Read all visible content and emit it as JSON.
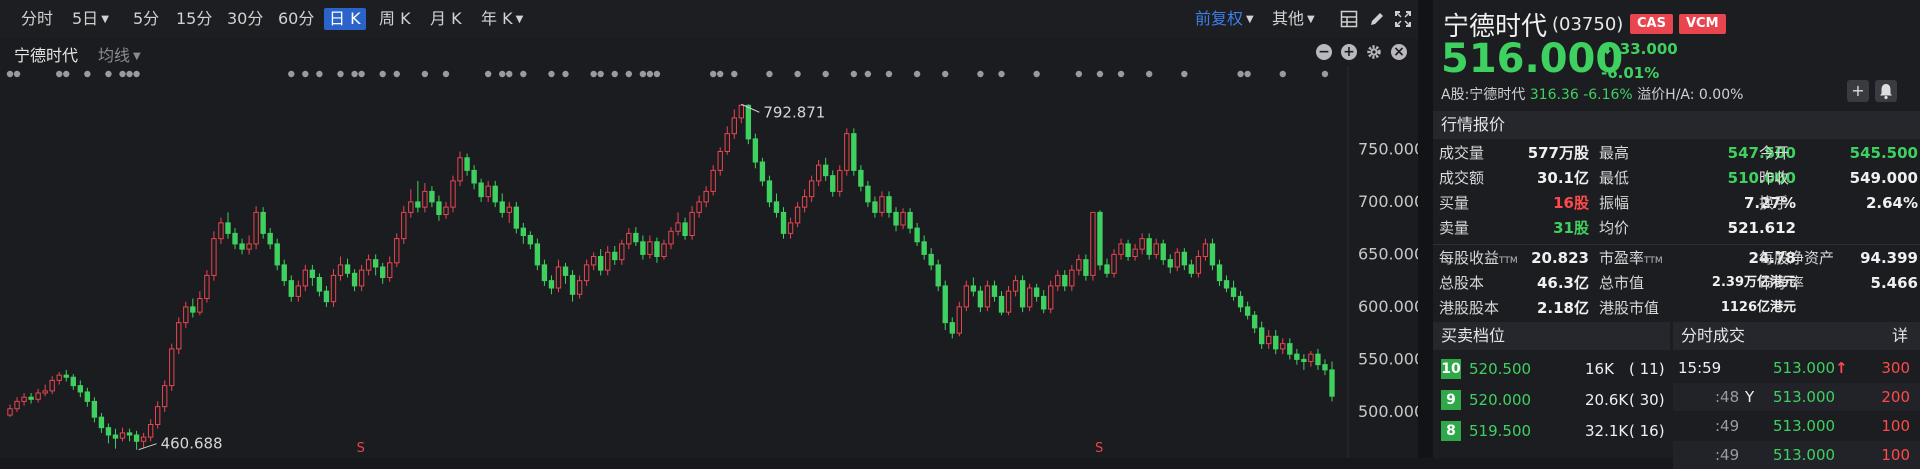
{
  "toolbar": {
    "periods": [
      "分时",
      "5日",
      "5分",
      "15分",
      "30分",
      "60分",
      "日 K",
      "周 K",
      "月 K",
      "年 K"
    ],
    "active": "日 K",
    "adjust": "前复权",
    "other": "其他"
  },
  "subbar": {
    "stock": "宁德时代",
    "ma": "均线"
  },
  "chart_data": {
    "type": "candlestick",
    "y_ticks": [
      "750.000",
      "700.000",
      "650.000",
      "600.000",
      "550.000",
      "500.000"
    ],
    "ylim": [
      458,
      818
    ],
    "high_label": "792.871",
    "low_label": "460.688",
    "marker": "S",
    "up_color": "#e8454f",
    "down_color": "#3fd160",
    "candles": [
      [
        497,
        503,
        495,
        507
      ],
      [
        503,
        510,
        500,
        514
      ],
      [
        510,
        514,
        506,
        518
      ],
      [
        514,
        512,
        508,
        518
      ],
      [
        512,
        518,
        509,
        522
      ],
      [
        518,
        520,
        515,
        526
      ],
      [
        520,
        530,
        517,
        534
      ],
      [
        530,
        535,
        526,
        538
      ],
      [
        535,
        533,
        529,
        540
      ],
      [
        533,
        525,
        521,
        536
      ],
      [
        525,
        519,
        514,
        530
      ],
      [
        519,
        510,
        505,
        523
      ],
      [
        510,
        495,
        490,
        514
      ],
      [
        495,
        485,
        480,
        499
      ],
      [
        485,
        478,
        470,
        489
      ],
      [
        478,
        475,
        465,
        484
      ],
      [
        475,
        480,
        472,
        485
      ],
      [
        480,
        478,
        472,
        484
      ],
      [
        478,
        472,
        464,
        482
      ],
      [
        472,
        476,
        466,
        480
      ],
      [
        476,
        488,
        472,
        493
      ],
      [
        488,
        505,
        484,
        510
      ],
      [
        505,
        525,
        500,
        530
      ],
      [
        525,
        560,
        520,
        565
      ],
      [
        560,
        585,
        555,
        590
      ],
      [
        585,
        600,
        580,
        605
      ],
      [
        600,
        595,
        590,
        608
      ],
      [
        595,
        608,
        592,
        615
      ],
      [
        608,
        630,
        604,
        635
      ],
      [
        630,
        665,
        625,
        672
      ],
      [
        665,
        680,
        660,
        685
      ],
      [
        680,
        670,
        665,
        690
      ],
      [
        670,
        660,
        655,
        675
      ],
      [
        660,
        655,
        650,
        665
      ],
      [
        655,
        660,
        650,
        668
      ],
      [
        660,
        690,
        655,
        696
      ],
      [
        690,
        670,
        665,
        695
      ],
      [
        670,
        660,
        655,
        675
      ],
      [
        660,
        640,
        635,
        665
      ],
      [
        640,
        625,
        620,
        645
      ],
      [
        625,
        610,
        605,
        630
      ],
      [
        610,
        620,
        605,
        625
      ],
      [
        620,
        635,
        615,
        640
      ],
      [
        635,
        628,
        620,
        640
      ],
      [
        628,
        615,
        610,
        632
      ],
      [
        615,
        605,
        600,
        620
      ],
      [
        605,
        630,
        600,
        636
      ],
      [
        630,
        640,
        625,
        648
      ],
      [
        640,
        632,
        628,
        646
      ],
      [
        632,
        620,
        615,
        636
      ],
      [
        620,
        635,
        615,
        640
      ],
      [
        635,
        645,
        630,
        650
      ],
      [
        645,
        638,
        630,
        650
      ],
      [
        638,
        628,
        622,
        642
      ],
      [
        628,
        642,
        624,
        648
      ],
      [
        642,
        665,
        638,
        670
      ],
      [
        665,
        690,
        660,
        696
      ],
      [
        690,
        700,
        685,
        712
      ],
      [
        700,
        695,
        690,
        720
      ],
      [
        695,
        710,
        690,
        718
      ],
      [
        710,
        700,
        695,
        715
      ],
      [
        700,
        688,
        682,
        706
      ],
      [
        688,
        695,
        684,
        700
      ],
      [
        695,
        720,
        690,
        725
      ],
      [
        720,
        742,
        715,
        748
      ],
      [
        742,
        730,
        725,
        746
      ],
      [
        730,
        718,
        712,
        735
      ],
      [
        718,
        705,
        700,
        722
      ],
      [
        705,
        715,
        700,
        720
      ],
      [
        715,
        700,
        695,
        720
      ],
      [
        700,
        690,
        685,
        708
      ],
      [
        690,
        695,
        680,
        700
      ],
      [
        695,
        675,
        670,
        700
      ],
      [
        675,
        668,
        660,
        680
      ],
      [
        668,
        660,
        655,
        672
      ],
      [
        660,
        640,
        635,
        665
      ],
      [
        640,
        625,
        620,
        645
      ],
      [
        625,
        618,
        612,
        630
      ],
      [
        618,
        638,
        614,
        645
      ],
      [
        638,
        630,
        622,
        642
      ],
      [
        630,
        612,
        605,
        635
      ],
      [
        612,
        625,
        608,
        630
      ],
      [
        625,
        640,
        620,
        645
      ],
      [
        640,
        648,
        635,
        652
      ],
      [
        648,
        635,
        630,
        655
      ],
      [
        635,
        652,
        630,
        658
      ],
      [
        652,
        645,
        640,
        658
      ],
      [
        645,
        660,
        640,
        664
      ],
      [
        660,
        670,
        655,
        675
      ],
      [
        670,
        662,
        658,
        676
      ],
      [
        662,
        650,
        645,
        668
      ],
      [
        650,
        662,
        646,
        668
      ],
      [
        662,
        648,
        642,
        666
      ],
      [
        648,
        660,
        645,
        664
      ],
      [
        660,
        672,
        655,
        676
      ],
      [
        672,
        680,
        668,
        690
      ],
      [
        680,
        668,
        664,
        685
      ],
      [
        668,
        690,
        664,
        696
      ],
      [
        690,
        700,
        685,
        706
      ],
      [
        700,
        710,
        695,
        715
      ],
      [
        710,
        730,
        706,
        735
      ],
      [
        730,
        748,
        725,
        752
      ],
      [
        748,
        765,
        745,
        772
      ],
      [
        765,
        780,
        760,
        788
      ],
      [
        780,
        792,
        775,
        793
      ],
      [
        792,
        760,
        755,
        793
      ],
      [
        760,
        738,
        732,
        765
      ],
      [
        738,
        720,
        715,
        742
      ],
      [
        720,
        700,
        695,
        725
      ],
      [
        700,
        690,
        685,
        708
      ],
      [
        690,
        670,
        665,
        695
      ],
      [
        670,
        680,
        665,
        685
      ],
      [
        680,
        695,
        676,
        700
      ],
      [
        695,
        705,
        690,
        712
      ],
      [
        705,
        720,
        700,
        725
      ],
      [
        720,
        735,
        715,
        740
      ],
      [
        735,
        725,
        720,
        742
      ],
      [
        725,
        710,
        705,
        730
      ],
      [
        710,
        730,
        705,
        735
      ],
      [
        730,
        765,
        725,
        770
      ],
      [
        765,
        730,
        725,
        770
      ],
      [
        730,
        715,
        710,
        735
      ],
      [
        715,
        700,
        695,
        720
      ],
      [
        700,
        690,
        685,
        705
      ],
      [
        690,
        705,
        686,
        710
      ],
      [
        705,
        690,
        685,
        710
      ],
      [
        690,
        678,
        672,
        695
      ],
      [
        678,
        690,
        674,
        694
      ],
      [
        690,
        675,
        670,
        694
      ],
      [
        675,
        662,
        658,
        680
      ],
      [
        662,
        650,
        645,
        668
      ],
      [
        650,
        640,
        635,
        656
      ],
      [
        640,
        620,
        615,
        645
      ],
      [
        620,
        585,
        578,
        625
      ],
      [
        585,
        575,
        570,
        590
      ],
      [
        575,
        600,
        572,
        605
      ],
      [
        600,
        620,
        596,
        625
      ],
      [
        620,
        615,
        610,
        628
      ],
      [
        615,
        600,
        595,
        620
      ],
      [
        600,
        620,
        596,
        625
      ],
      [
        620,
        610,
        605,
        625
      ],
      [
        610,
        595,
        592,
        615
      ],
      [
        595,
        615,
        592,
        620
      ],
      [
        615,
        625,
        610,
        630
      ],
      [
        625,
        600,
        595,
        630
      ],
      [
        600,
        618,
        596,
        622
      ],
      [
        618,
        610,
        605,
        622
      ],
      [
        610,
        598,
        594,
        616
      ],
      [
        598,
        620,
        594,
        625
      ],
      [
        620,
        630,
        615,
        635
      ],
      [
        630,
        620,
        615,
        635
      ],
      [
        620,
        635,
        615,
        640
      ],
      [
        635,
        645,
        630,
        650
      ],
      [
        645,
        630,
        625,
        650
      ],
      [
        630,
        690,
        625,
        690
      ],
      [
        690,
        640,
        635,
        692
      ],
      [
        640,
        632,
        628,
        646
      ],
      [
        632,
        650,
        628,
        655
      ],
      [
        650,
        660,
        645,
        665
      ],
      [
        660,
        648,
        644,
        664
      ],
      [
        648,
        655,
        644,
        660
      ],
      [
        655,
        665,
        650,
        670
      ],
      [
        665,
        650,
        645,
        670
      ],
      [
        650,
        660,
        646,
        665
      ],
      [
        660,
        645,
        640,
        664
      ],
      [
        645,
        638,
        632,
        650
      ],
      [
        638,
        652,
        634,
        656
      ],
      [
        652,
        640,
        635,
        656
      ],
      [
        640,
        632,
        628,
        645
      ],
      [
        632,
        648,
        628,
        654
      ],
      [
        648,
        660,
        644,
        665
      ],
      [
        660,
        640,
        635,
        665
      ],
      [
        640,
        625,
        620,
        645
      ],
      [
        625,
        618,
        614,
        630
      ],
      [
        618,
        610,
        606,
        625
      ],
      [
        610,
        600,
        595,
        615
      ],
      [
        600,
        592,
        588,
        605
      ],
      [
        592,
        580,
        575,
        596
      ],
      [
        580,
        565,
        560,
        586
      ],
      [
        565,
        572,
        560,
        578
      ],
      [
        572,
        560,
        555,
        578
      ],
      [
        560,
        565,
        555,
        570
      ],
      [
        565,
        555,
        550,
        570
      ],
      [
        555,
        550,
        545,
        560
      ],
      [
        550,
        548,
        540,
        555
      ],
      [
        548,
        555,
        543,
        558
      ],
      [
        555,
        545,
        540,
        560
      ],
      [
        545,
        540,
        535,
        550
      ],
      [
        540,
        515,
        510,
        548
      ]
    ]
  },
  "quote": {
    "name": "宁德时代",
    "code": "(03750)",
    "badges": [
      "CAS",
      "VCM"
    ],
    "price": "516.000",
    "change": "-33.000",
    "change_pct": "-6.01%",
    "a_share_label": "A股:宁德时代",
    "a_share_price": "316.36",
    "a_share_pct": "-6.16%",
    "premium": "溢价H/A: 0.00%"
  },
  "market": {
    "title": "行情报价",
    "rows": [
      [
        [
          "成交量",
          "577万股",
          "w"
        ],
        [
          "最高",
          "547.500",
          "gr"
        ],
        [
          "今开",
          "545.500",
          "gr"
        ]
      ],
      [
        [
          "成交额",
          "30.1亿",
          "w"
        ],
        [
          "最低",
          "510.000",
          "gr"
        ],
        [
          "昨收",
          "549.000",
          "w"
        ]
      ],
      [
        [
          "买量",
          "16股",
          "rd"
        ],
        [
          "振幅",
          "7.27%",
          "w"
        ],
        [
          "换手",
          "2.64%",
          "w"
        ]
      ],
      [
        [
          "卖量",
          "31股",
          "gr"
        ],
        [
          "均价",
          "521.612",
          "w"
        ],
        [
          "",
          "",
          "w"
        ]
      ]
    ],
    "rows2": [
      [
        [
          "每股收益",
          "TTM",
          "20.823"
        ],
        [
          "市盈率",
          "TTM",
          "24.78"
        ],
        [
          "每股净资产",
          "",
          "94.399"
        ]
      ],
      [
        [
          "总股本",
          "",
          "46.3亿"
        ],
        [
          "总市值",
          "",
          "2.39万亿港元"
        ],
        [
          "市净率",
          "",
          "5.466"
        ]
      ],
      [
        [
          "港股股本",
          "",
          "2.18亿"
        ],
        [
          "港股市值",
          "",
          "1126亿港元"
        ],
        [
          "",
          "",
          ""
        ]
      ]
    ]
  },
  "orderbook": {
    "title": "买卖档位",
    "levels": [
      {
        "lvl": "10",
        "price": "520.500",
        "vol": "16K",
        "cnt": "( 11)"
      },
      {
        "lvl": "9",
        "price": "520.000",
        "vol": "20.6K",
        "cnt": "( 30)"
      },
      {
        "lvl": "8",
        "price": "519.500",
        "vol": "32.1K",
        "cnt": "( 16)"
      }
    ]
  },
  "timesales": {
    "title": "分时成交",
    "detail": "详",
    "rows": [
      {
        "time": "15:59",
        "flag": "",
        "price": "513.000",
        "arrow": "↑",
        "vol": "300"
      },
      {
        "time": ":48",
        "flag": "Y",
        "price": "513.000",
        "arrow": "",
        "vol": "200"
      },
      {
        "time": ":49",
        "flag": "",
        "price": "513.000",
        "arrow": "",
        "vol": "100"
      },
      {
        "time": ":49",
        "flag": "",
        "price": "513.000",
        "arrow": "",
        "vol": "100"
      }
    ]
  }
}
